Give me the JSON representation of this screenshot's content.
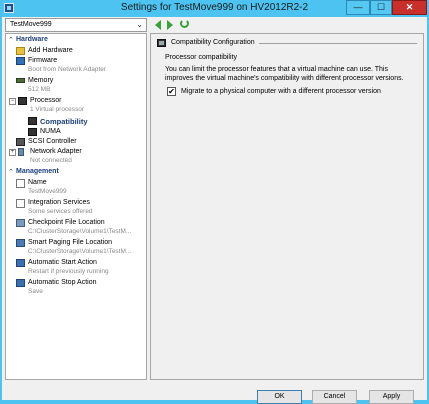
{
  "window": {
    "title": "Settings for TestMove999 on HV2012R2-2",
    "min_glyph": "—",
    "max_glyph": "☐",
    "close_glyph": "✕"
  },
  "toolbar": {
    "vm_selected": "TestMove999",
    "dropdown_glyph": "⌄"
  },
  "tree": {
    "hardware": {
      "chevron": "⌃",
      "label": "Hardware"
    },
    "management": {
      "chevron": "⌃",
      "label": "Management"
    },
    "items": {
      "add_hardware": {
        "label": "Add Hardware"
      },
      "firmware": {
        "label": "Firmware",
        "sub": "Boot from Network Adapter"
      },
      "memory": {
        "label": "Memory",
        "sub": "512 MB"
      },
      "processor": {
        "expander": "−",
        "label": "Processor",
        "sub": "1 Virtual processor"
      },
      "compatibility": {
        "label": "Compatibility"
      },
      "numa": {
        "label": "NUMA"
      },
      "scsi": {
        "label": "SCSI Controller"
      },
      "network": {
        "expander": "+",
        "label": "Network Adapter",
        "sub": "Not connected"
      },
      "name": {
        "label": "Name",
        "sub": "TestMove999"
      },
      "integration": {
        "label": "Integration Services",
        "sub": "Some services offered"
      },
      "checkpoint": {
        "label": "Checkpoint File Location",
        "sub": "C:\\ClusterStorage\\Volume1\\TestM..."
      },
      "smart_paging": {
        "label": "Smart Paging File Location",
        "sub": "C:\\ClusterStorage\\Volume1\\TestM..."
      },
      "auto_start": {
        "label": "Automatic Start Action",
        "sub": "Restart if previously running"
      },
      "auto_stop": {
        "label": "Automatic Stop Action",
        "sub": "Save"
      }
    }
  },
  "panel": {
    "heading": "Compatibility Configuration",
    "group_title": "Processor compatibility",
    "description": "You can limit the processor features that a virtual machine can use. This improves the virtual machine's compatibility with different processor versions.",
    "checkbox_label": "Migrate to a physical computer with a different processor version",
    "checkbox_checked": true,
    "check_glyph": "✔"
  },
  "buttons": {
    "ok": "OK",
    "cancel": "Cancel",
    "apply": "Apply"
  }
}
